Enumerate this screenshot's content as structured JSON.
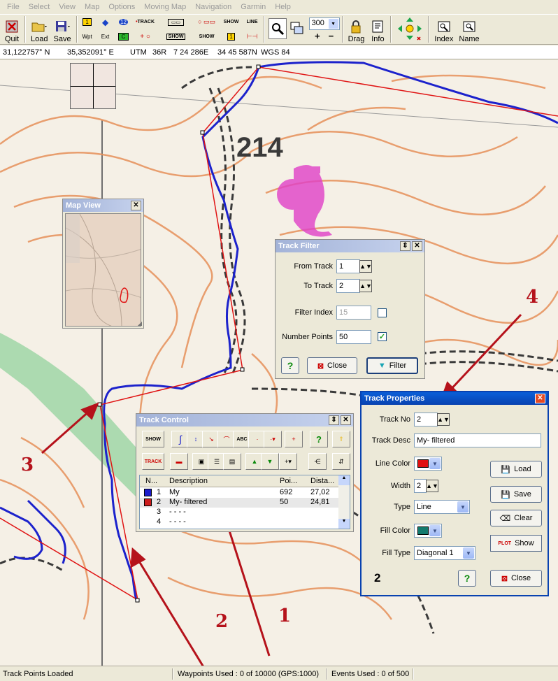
{
  "menu": [
    "File",
    "Select",
    "View",
    "Map",
    "Options",
    "Moving Map",
    "Navigation",
    "Garmin",
    "Help"
  ],
  "toolbar": {
    "quit": "Quit",
    "load": "Load",
    "save": "Save",
    "wpt": "Wpt",
    "ext": "Ext",
    "route_num": "12",
    "c_label": "C",
    "track_label": "TRACK",
    "show_label": "SHOW",
    "line_label": "LINE",
    "zoom_value": "300",
    "drag": "Drag",
    "info": "Info",
    "index": "Index",
    "name": "Name"
  },
  "coords": {
    "lat": "31,122757° N",
    "lon": "35,352091° E",
    "utm_label": "UTM",
    "zone": "36R",
    "easting": "7 24 286E",
    "northing": "34 45 587N",
    "datum": "WGS 84"
  },
  "map": {
    "elevation_label": "214"
  },
  "map_view": {
    "title": "Map View"
  },
  "track_filter": {
    "title": "Track Filter",
    "from_track_label": "From Track",
    "from_track": "1",
    "to_track_label": "To Track",
    "to_track": "2",
    "filter_index_label": "Filter Index",
    "filter_index": "15",
    "number_points_label": "Number Points",
    "number_points": "50",
    "help": "?",
    "close": "Close",
    "filter": "Filter"
  },
  "track_control": {
    "title": "Track Control",
    "columns": [
      "N...",
      "Description",
      "Poi...",
      "Dista..."
    ],
    "rows": [
      {
        "n": "1",
        "desc": "My",
        "points": "692",
        "dist": "27,02",
        "color": "#1c1ccc"
      },
      {
        "n": "2",
        "desc": "My- filtered",
        "points": "50",
        "dist": "24,81",
        "color": "#cc1c1c"
      },
      {
        "n": "3",
        "desc": "- - - -",
        "points": "",
        "dist": "",
        "color": ""
      },
      {
        "n": "4",
        "desc": "- - - -",
        "points": "",
        "dist": "",
        "color": ""
      }
    ],
    "show": "SHOW",
    "abc": "ABC",
    "track": "TRACK",
    "help": "?"
  },
  "track_properties": {
    "title": "Track Properties",
    "track_no_label": "Track No",
    "track_no": "2",
    "track_desc_label": "Track Desc",
    "track_desc": "My- filtered",
    "line_color_label": "Line Color",
    "line_color": "#e01010",
    "width_label": "Width",
    "width": "2",
    "type_label": "Type",
    "type": "Line",
    "fill_color_label": "Fill Color",
    "fill_color": "#127a6e",
    "fill_type_label": "Fill Type",
    "fill_type": "Diagonal 1",
    "load": "Load",
    "save": "Save",
    "clear": "Clear",
    "plot": "PLOT",
    "show": "Show",
    "close": "Close",
    "help": "?",
    "index_num": "2"
  },
  "annotations": [
    "1",
    "2",
    "3",
    "4"
  ],
  "status": {
    "left": "Track Points Loaded",
    "waypoints": "Waypoints Used : 0 of 10000  (GPS:1000)",
    "events": "Events Used : 0 of 500"
  },
  "colors": {
    "track_blue": "#1c22cc",
    "filtered_red": "#e01414",
    "annotation": "#b5121b"
  }
}
